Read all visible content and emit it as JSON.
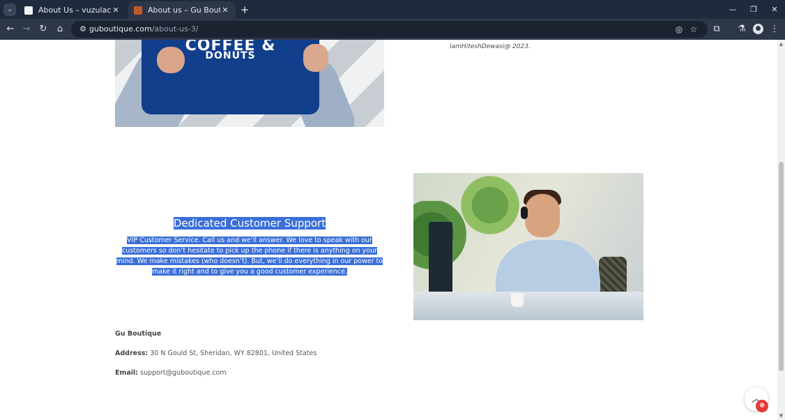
{
  "browser": {
    "tabs": [
      {
        "title": "About Us – vuzulaca.com",
        "active": false
      },
      {
        "title": "About us – Gu Boutique",
        "active": true
      }
    ],
    "url_host": "guboutique.com",
    "url_path": "/about-us-3/",
    "icons": {
      "tab_search": "chevron-down-icon",
      "new_tab": "plus-icon",
      "back": "arrow-left-icon",
      "forward": "arrow-right-icon",
      "reload": "reload-icon",
      "home": "home-icon",
      "site_info": "tune-icon",
      "eye_off": "eye-off-icon",
      "bookmark": "star-icon",
      "extensions": "puzzle-icon",
      "labs": "flask-icon",
      "profile": "profile-icon",
      "menu": "kebab-menu-icon"
    }
  },
  "page": {
    "image1": {
      "slogan_line1": "COFFEE &",
      "slogan_line2": "DONUTS"
    },
    "credit": "IamHiteshDewasi@ 2023.",
    "support": {
      "heading": "Dedicated Customer Support",
      "body": "VIP Customer Service. Call us and we’ll answer. We love to speak with our customers so don’t hesitate to pick up the phone if there is anything on your mind. We make mistakes (who doesn’t). But, we’ll do everything in our power to make it right and to give you a good customer experience."
    },
    "footer": {
      "brand": "Gu Boutique",
      "address_label": "Address:",
      "address": "30 N Gould St, Sheridan, WY 82801, United States",
      "email_label": "Email:",
      "email": "support@guboutique.com"
    },
    "widgets": {
      "scroll_top_icon": "chevron-up-icon",
      "badge_icon": "gift-icon"
    },
    "colors": {
      "selection": "#3a6fd8",
      "chrome_bg": "#1f2a3c",
      "toolbar_bg": "#2d3748"
    }
  }
}
